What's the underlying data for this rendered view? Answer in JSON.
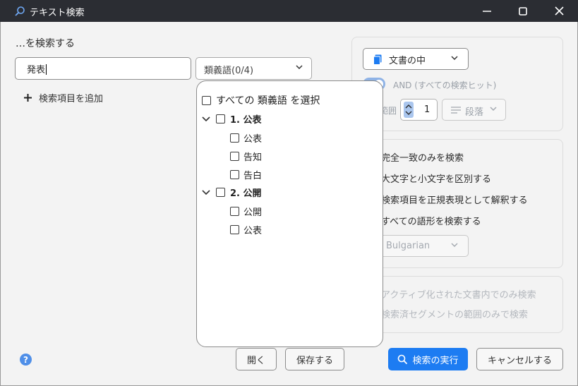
{
  "window": {
    "title": "テキスト検索"
  },
  "search": {
    "heading": "…を検索する",
    "input_value": "発表",
    "synonyms_dropdown": "類義語(0/4)",
    "add_item": "検索項目を追加"
  },
  "synonyms_popup": {
    "select_all": "すべての 類義語 を選択",
    "groups": [
      {
        "label": "1. 公表",
        "items": [
          "公表",
          "告知",
          "告白"
        ]
      },
      {
        "label": "2. 公開",
        "items": [
          "公開",
          "公表"
        ]
      }
    ]
  },
  "options": {
    "scope_dropdown": "文書の中",
    "and_label": "AND (すべての検索ヒット)",
    "range_label": "範囲",
    "range_value": "1",
    "paragraph_dropdown": "段落",
    "exact_match": "完全一致のみを検索",
    "case_sensitive": "大文字と小文字を区別する",
    "regex": "検索項目を正規表現として解釈する",
    "all_word_forms": "すべての語形を検索する",
    "language_dropdown": "Bulgarian",
    "active_doc_only": "アクティブ化された文書内でのみ検索",
    "searched_segments_only": "検索済セグメントの範囲のみで検索"
  },
  "buttons": {
    "help": "?",
    "open": "開く",
    "save": "保存する",
    "run_search": "検索の実行",
    "cancel": "キャンセルする"
  },
  "colors": {
    "accent": "#1d7cf2",
    "titlebar": "#2b2d33",
    "toggle": "#8fb3e6"
  },
  "icons": [
    "search-icon",
    "minimize-icon",
    "maximize-icon",
    "close-icon",
    "plus-icon",
    "document-icon",
    "chevron-down-icon",
    "help-icon"
  ]
}
